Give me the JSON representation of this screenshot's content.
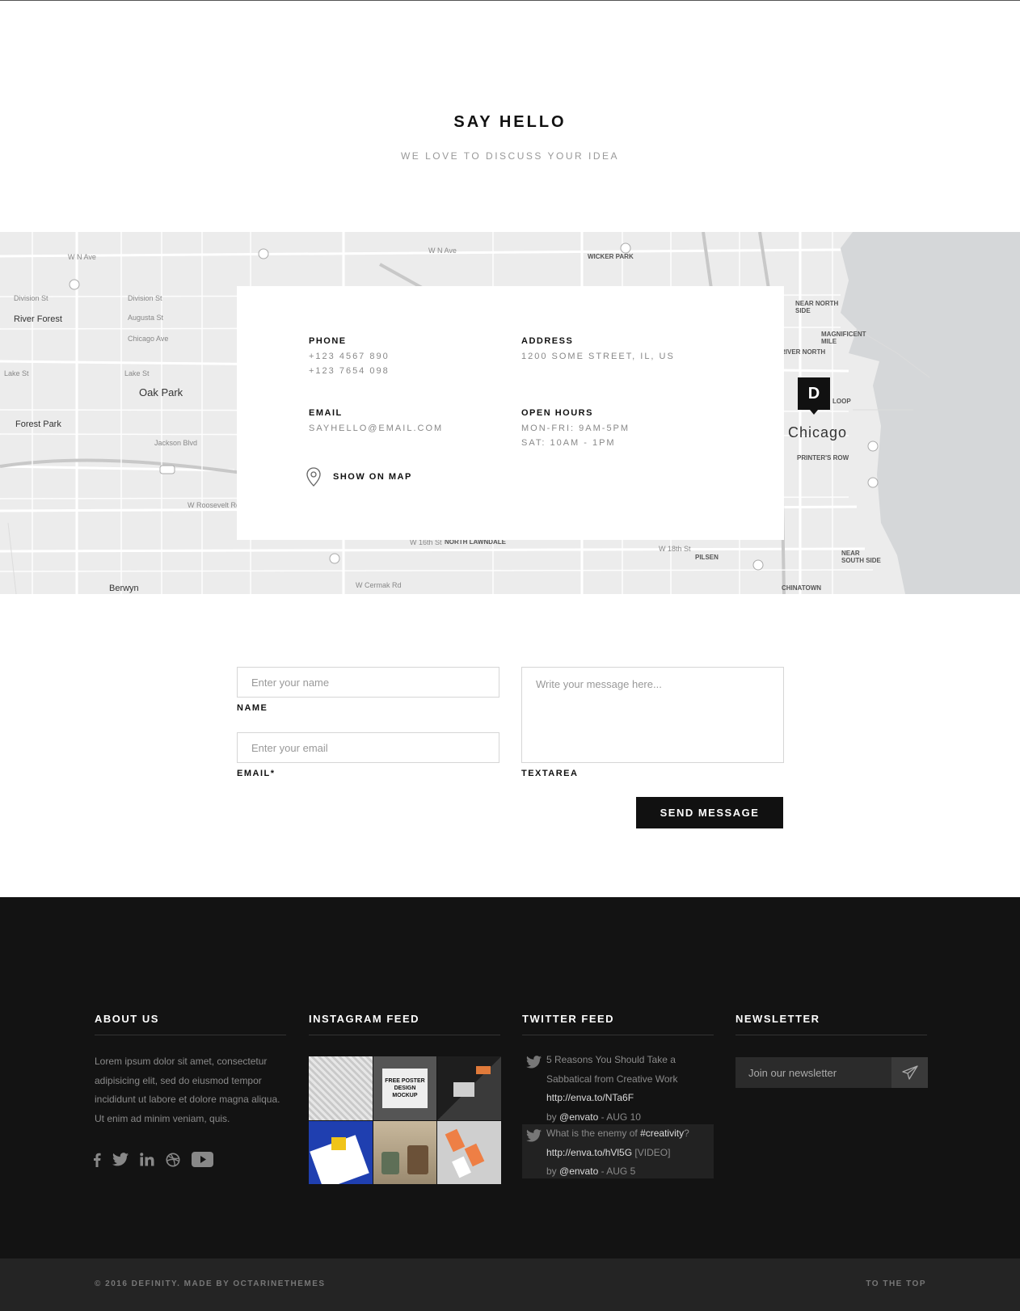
{
  "header": {
    "title": "SAY HELLO",
    "subtitle": "WE LOVE TO DISCUSS YOUR IDEA"
  },
  "map": {
    "marker_letter": "D",
    "city": "Chicago",
    "labels": {
      "river_forest": "River Forest",
      "oak_park": "Oak Park",
      "forest_park": "Forest Park",
      "berwyn": "Berwyn",
      "wicker_park": "WICKER PARK",
      "near_north_side": "NEAR NORTH SIDE",
      "magnificent_mile": "MAGNIFICENT MILE",
      "river_north": "RIVER NORTH",
      "loop": "LOOP",
      "printers_row": "PRINTER'S ROW",
      "pilsen": "PILSEN",
      "near_south_side": "NEAR SOUTH SIDE",
      "chinatown": "CHINATOWN",
      "north_lawndale": "NORTH LAWNDALE",
      "division_st": "Division St",
      "augusta_st": "Augusta St",
      "chicago_ave": "Chicago Ave",
      "lake_st": "Lake St",
      "jackson_blvd": "Jackson Blvd",
      "roosevelt_rd": "W Roosevelt Rd",
      "cermak_rd": "W Cermak Rd",
      "w_north_ave": "W N Ave",
      "w_16th_st": "W 16th St",
      "w_18th_st": "W 18th St"
    }
  },
  "contact": {
    "phone_label": "PHONE",
    "phone_1": "+123 4567 890",
    "phone_2": "+123 7654 098",
    "address_label": "ADDRESS",
    "address": "1200 SOME STREET, IL, US",
    "email_label": "EMAIL",
    "email": "SAYHELLO@EMAIL.COM",
    "hours_label": "OPEN HOURS",
    "hours_1": "MON-FRI: 9AM-5PM",
    "hours_2": "SAT: 10AM - 1PM",
    "show_on_map": "SHOW ON MAP"
  },
  "form": {
    "name_placeholder": "Enter your name",
    "name_label": "NAME",
    "email_placeholder": "Enter your email",
    "email_label": "EMAIL*",
    "message_placeholder": "Write your message here...",
    "message_label": "TEXTAREA",
    "submit_label": "SEND MESSAGE"
  },
  "footer": {
    "about": {
      "title": "ABOUT US",
      "text": "Lorem ipsum dolor sit amet, consectetur adipisicing elit, sed do eiusmod tempor incididunt ut labore et dolore magna aliqua. Ut enim ad minim veniam, quis.",
      "socials": [
        "facebook-icon",
        "twitter-icon",
        "linkedin-icon",
        "dribbble-icon",
        "youtube-icon"
      ]
    },
    "instagram": {
      "title": "INSTAGRAM FEED",
      "tiles": [
        {
          "color": "#d9d9d9",
          "caption": ""
        },
        {
          "color": "#5a5a5a",
          "caption": "FREE POSTER DESIGN MOCKUP"
        },
        {
          "color": "#2a2a2a",
          "caption": ""
        },
        {
          "color": "#1f3fb0",
          "caption": ""
        },
        {
          "color": "#b9a98e",
          "caption": ""
        },
        {
          "color": "#c4c4c4",
          "caption": ""
        }
      ]
    },
    "twitter": {
      "title": "TWITTER FEED",
      "tweets": [
        {
          "text": "5 Reasons You Should Take a Sabbatical from Creative Work",
          "link": "http://enva.to/NTa6F",
          "by": "by",
          "handle": "@envato",
          "date": "- AUG 10"
        },
        {
          "text": "What is the enemy of",
          "hashtag": "#creativity",
          "suffix": "?",
          "link": "http://enva.to/hVl5G",
          "tag": "[VIDEO]",
          "by": "by",
          "handle": "@envato",
          "date": "- AUG 5"
        }
      ]
    },
    "newsletter": {
      "title": "NEWSLETTER",
      "placeholder": "Join our newsletter"
    },
    "copyright": "© 2016 DEFINITY. MADE BY OCTARINETHEMES",
    "to_top": "TO THE TOP"
  },
  "colors": {
    "accent": "#111111",
    "footer_bg": "#131313",
    "bottom_bar_bg": "#242424",
    "map_bg": "#ececec",
    "water": "#d5d7d9"
  }
}
